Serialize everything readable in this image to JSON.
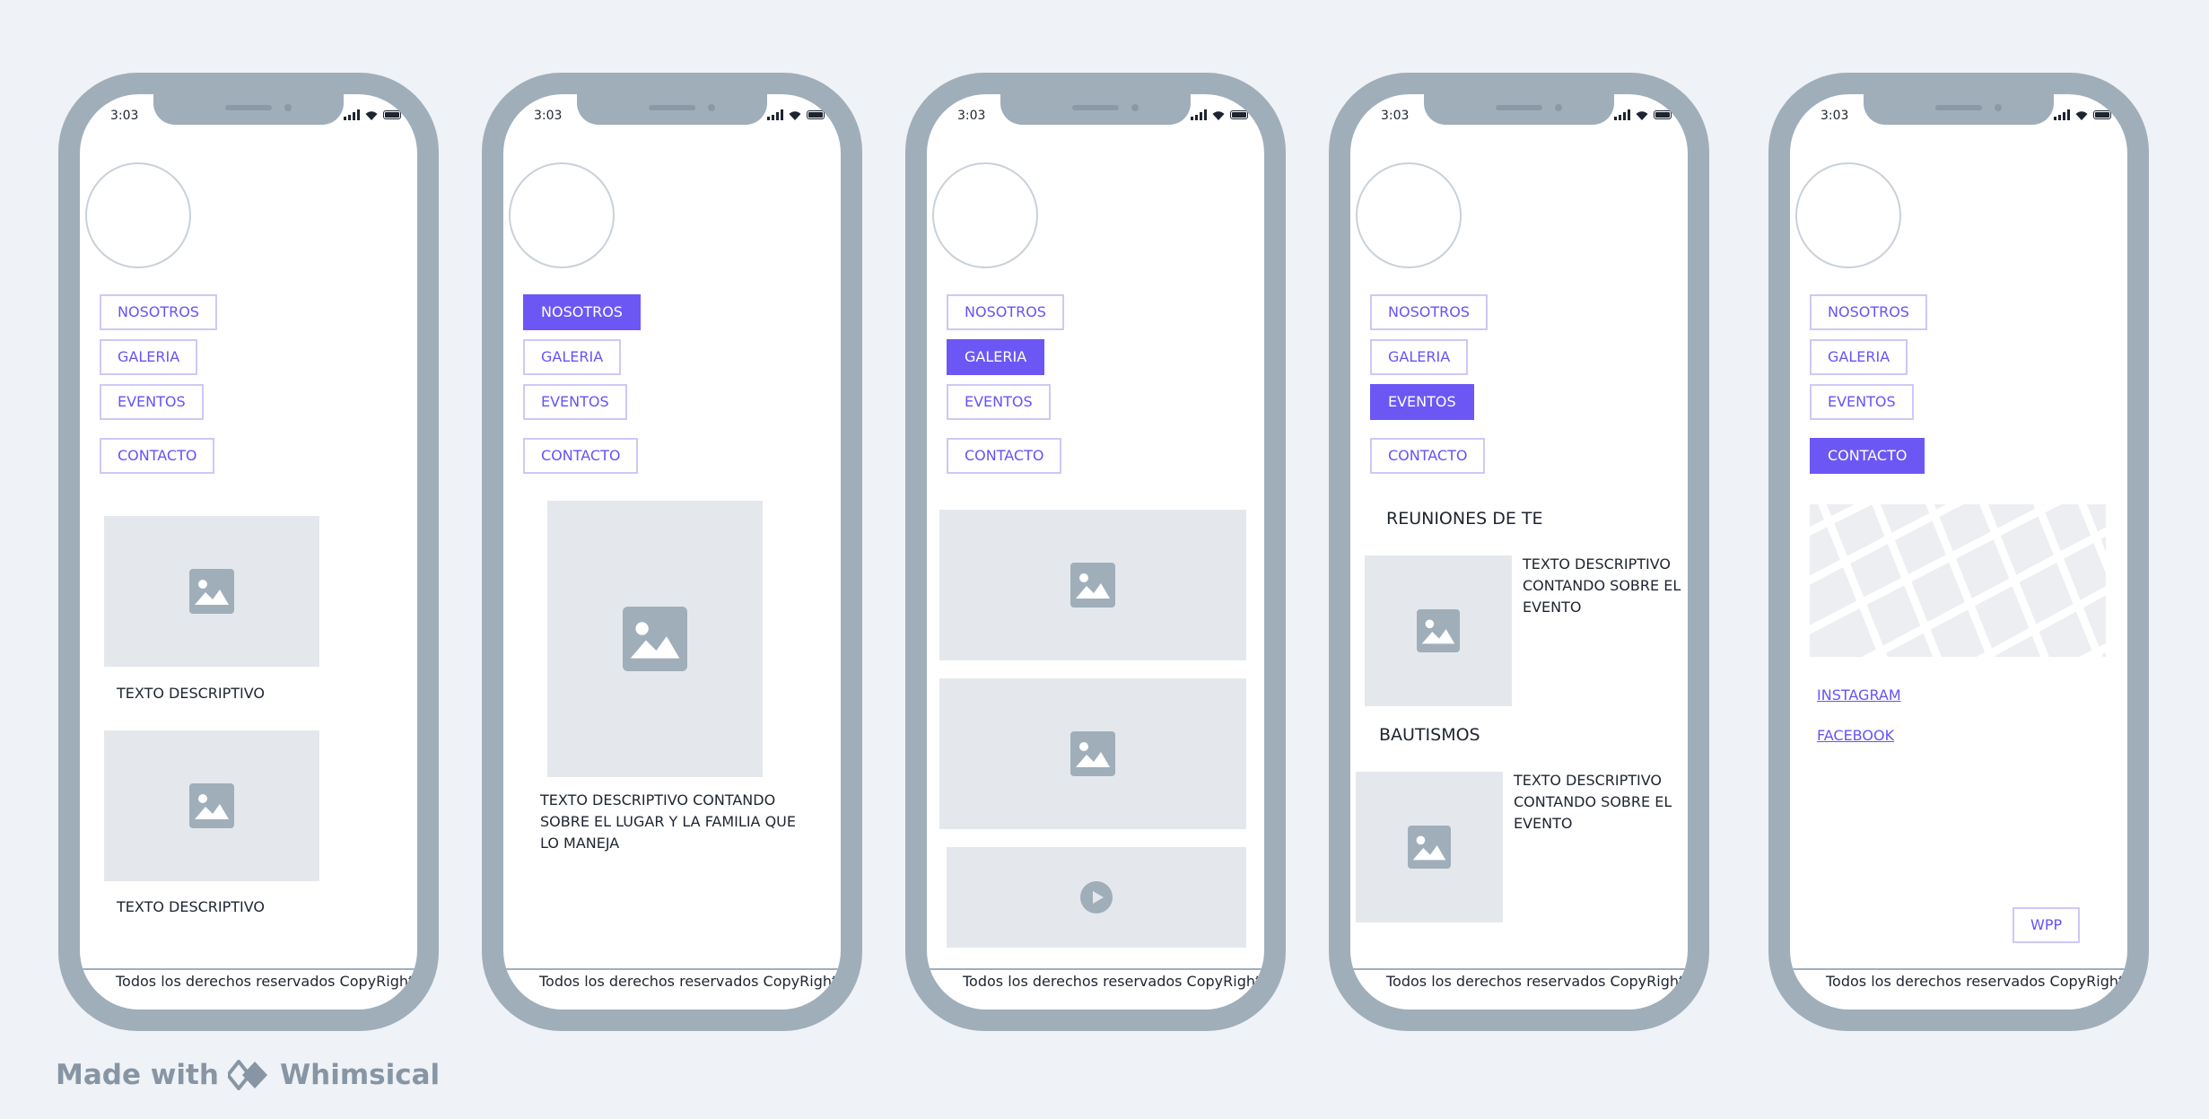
{
  "status": {
    "time": "3:03"
  },
  "nav": {
    "nosotros": "NOSOTROS",
    "galeria": "GALERIA",
    "eventos": "EVENTOS",
    "contacto": "CONTACTO"
  },
  "footer": "Todos los derechos reservados CopyRight",
  "screen1": {
    "caption1": "TEXTO DESCRIPTIVO",
    "caption2": "TEXTO DESCRIPTIVO"
  },
  "screen2": {
    "description": "TEXTO DESCRIPTIVO CONTANDO SOBRE EL LUGAR Y LA FAMILIA QUE LO MANEJA"
  },
  "screen4": {
    "event1_title": "REUNIONES DE TE",
    "event1_text": "TEXTO DESCRIPTIVO CONTANDO SOBRE EL EVENTO",
    "event2_title": "BAUTISMOS",
    "event2_text": "TEXTO DESCRIPTIVO CONTANDO SOBRE EL EVENTO"
  },
  "screen5": {
    "instagram": "INSTAGRAM",
    "facebook": "FACEBOOK",
    "wpp": "WPP"
  },
  "brand": {
    "prefix": "Made with",
    "name": "Whimsical"
  },
  "colors": {
    "accent": "#6c57f5",
    "frame": "#a0aeba",
    "placeholder": "#e4e8ec",
    "background": "#eff2f6"
  },
  "icons": [
    "image-icon",
    "play-icon",
    "signal-icon",
    "wifi-icon",
    "battery-icon",
    "whimsical-logo-icon"
  ]
}
